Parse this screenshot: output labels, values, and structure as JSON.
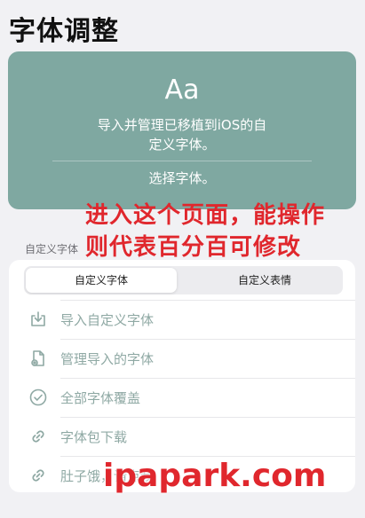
{
  "page": {
    "title": "字体调整"
  },
  "hero": {
    "sample": "Aa",
    "description_line1": "导入并管理已移植到iOS的自",
    "description_line2": "定义字体。",
    "choose_label": "选择字体。"
  },
  "overlay_text": {
    "line1": "进入这个页面，能操作",
    "line2": "则代表百分百可修改"
  },
  "section": {
    "label": "自定义字体"
  },
  "segmented": {
    "options": [
      "自定义字体",
      "自定义表情"
    ],
    "selected": "自定义字体"
  },
  "menu": {
    "items": [
      {
        "label": "导入自定义字体",
        "icon": "import-icon"
      },
      {
        "label": "管理导入的字体",
        "icon": "manage-doc-icon"
      },
      {
        "label": "全部字体覆盖",
        "icon": "checkmark-circle-icon"
      },
      {
        "label": "字体包下载",
        "icon": "link-icon"
      },
      {
        "label": "肚子饿，请点我",
        "icon": "link-icon"
      }
    ]
  },
  "watermark": {
    "text": "ipapark.com"
  },
  "colors": {
    "accent": "#7fa8a1",
    "overlay_red": "#e0272d",
    "item_text": "#8fa9a4"
  }
}
